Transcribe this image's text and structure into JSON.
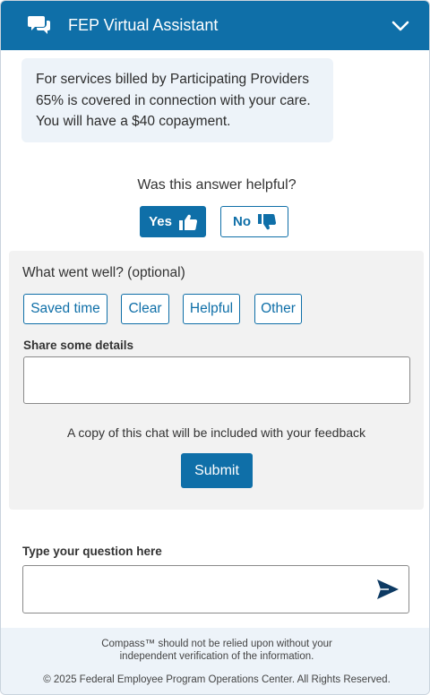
{
  "header": {
    "title": "FEP Virtual Assistant",
    "chat_icon": "chat-bubbles-icon",
    "collapse_icon": "chevron-down-icon"
  },
  "message": {
    "line1": "For services billed by Participating Providers",
    "line2": "65% is covered in connection with your care.",
    "line3": "You will have a $40 copayment."
  },
  "helpful": {
    "question": "Was this answer helpful?",
    "yes_label": "Yes",
    "yes_icon": "thumbs-up-icon",
    "no_label": "No",
    "no_icon": "thumbs-down-icon"
  },
  "feedback": {
    "went_well_label": "What went well? (optional)",
    "chips": [
      "Saved time",
      "Clear",
      "Helpful",
      "Other"
    ],
    "details_label": "Share some details",
    "details_value": "",
    "copy_note": "A copy of this chat will be included with your feedback",
    "submit_label": "Submit"
  },
  "question_input": {
    "label": "Type your question here",
    "value": "",
    "send_icon": "send-arrow-icon"
  },
  "footer": {
    "disclaimer_line1": "Compass™ should not be relied upon without your",
    "disclaimer_line2": "independent verification of the information.",
    "copyright": "© 2025 Federal Employee Program Operations Center. All Rights Reserved."
  },
  "colors": {
    "brand_blue": "#0f6fa8",
    "bubble_bg": "#edf3f9",
    "panel_bg": "#f2f2f2"
  }
}
